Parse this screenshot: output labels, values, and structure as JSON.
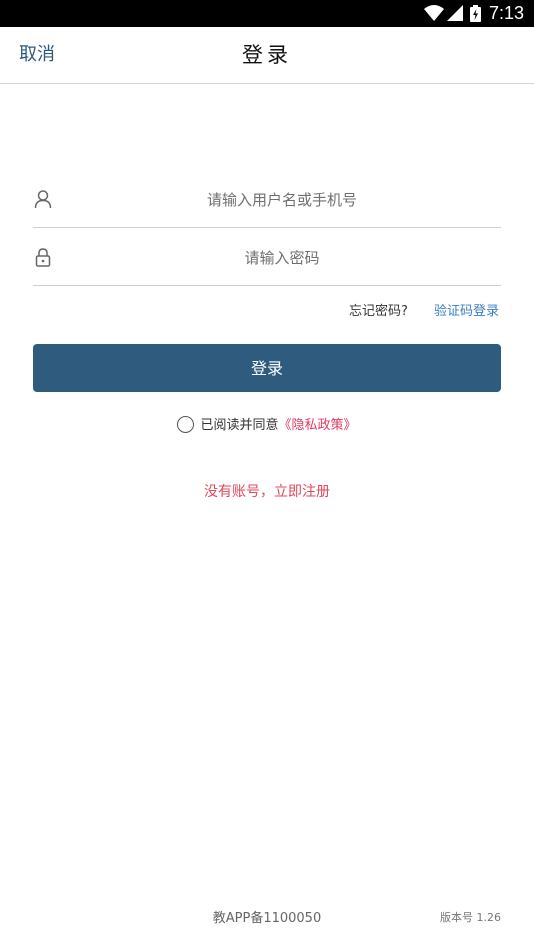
{
  "status_bar": {
    "time": "7:13",
    "icons": [
      "wifi-icon",
      "signal-icon",
      "battery-charging-icon"
    ]
  },
  "header": {
    "cancel_label": "取消",
    "title": "登录"
  },
  "form": {
    "username": {
      "value": "",
      "placeholder": "请输入用户名或手机号",
      "icon": "user-icon"
    },
    "password": {
      "value": "",
      "placeholder": "请输入密码",
      "icon": "lock-icon"
    },
    "forgot_label": "忘记密码?",
    "sms_login_label": "验证码登录",
    "login_button_label": "登录"
  },
  "agreement": {
    "checked": false,
    "prefix": "已阅读并同意",
    "policy_label": "《隐私政策》"
  },
  "register_label": "没有账号，立即注册",
  "footer": {
    "icp": "教APP备1100050",
    "version": "版本号 1.26"
  },
  "colors": {
    "accent": "#2f5b7e",
    "link_blue": "#3a7fc4",
    "link_red": "#e0485a",
    "policy_pink": "#e03b63"
  }
}
